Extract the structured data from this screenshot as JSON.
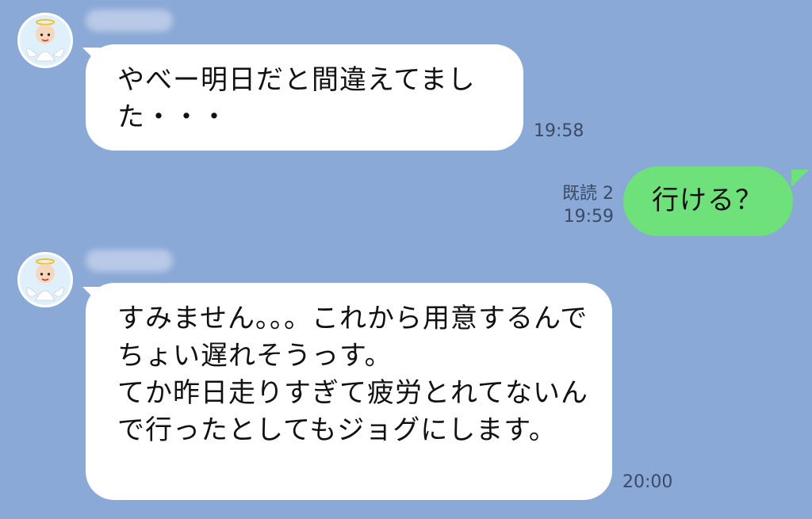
{
  "messages": [
    {
      "direction": "incoming",
      "text": "やべー明日だと間違えてました・・・",
      "time": "19:58"
    },
    {
      "direction": "outgoing",
      "text": "行ける？",
      "read_status": "既読 2",
      "time": "19:59"
    },
    {
      "direction": "incoming",
      "text": "すみません。。。これから用意するんでちょい遅れそうっす。\nてか昨日走りすぎて疲労とれてないんで行ったとしてもジョグにします。",
      "time": "20:00"
    }
  ],
  "colors": {
    "background": "#8aa9d6",
    "incoming_bubble": "#ffffff",
    "outgoing_bubble": "#6ee17a",
    "meta_text": "#3b4a66"
  },
  "icons": {
    "avatar": "angel-character-avatar-icon"
  }
}
